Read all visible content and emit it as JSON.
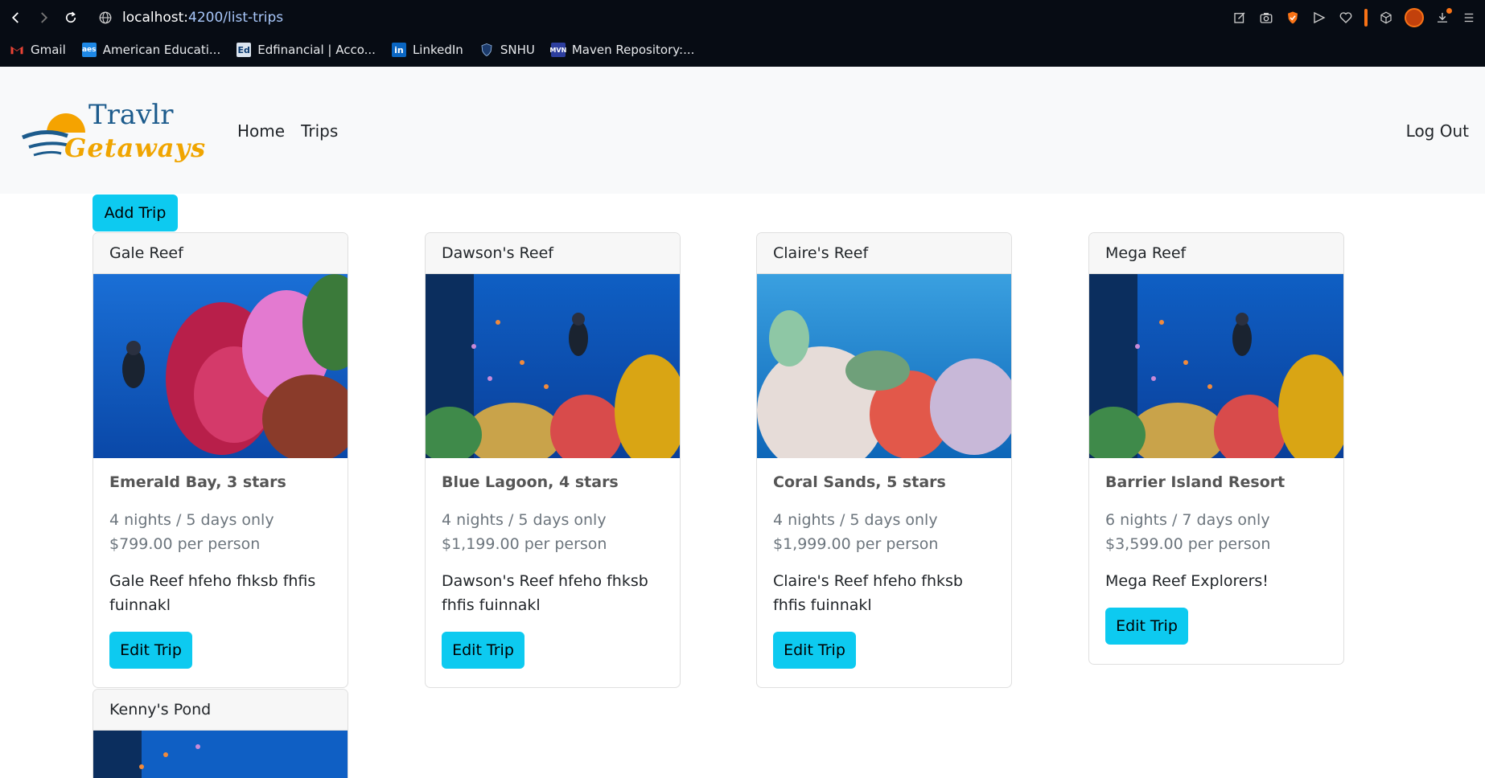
{
  "browser": {
    "url_host": "localhost:",
    "url_rest": "4200/list-trips",
    "bookmarks": [
      {
        "label": "Gmail",
        "icon": "gmail-icon"
      },
      {
        "label": "American Educati...",
        "icon": "aes-icon"
      },
      {
        "label": "Edfinancial | Acco...",
        "icon": "edfinancial-icon"
      },
      {
        "label": "LinkedIn",
        "icon": "linkedin-icon"
      },
      {
        "label": "SNHU",
        "icon": "snhu-shield-icon"
      },
      {
        "label": "Maven Repository:...",
        "icon": "maven-icon"
      }
    ]
  },
  "navbar": {
    "brand_top": "Travlr",
    "brand_bottom": "Getaways",
    "links": [
      "Home",
      "Trips"
    ],
    "logout": "Log Out"
  },
  "main": {
    "add_trip_label": "Add Trip",
    "trips": [
      {
        "name": "Gale Reef",
        "resort": "Emerald Bay, 3 stars",
        "price": "4 nights / 5 days only $799.00 per person",
        "description": "Gale Reef hfeho fhksb fhfis fuinnakl",
        "button": "Edit Trip"
      },
      {
        "name": "Dawson's Reef",
        "resort": "Blue Lagoon, 4 stars",
        "price": "4 nights / 5 days only $1,199.00 per person",
        "description": "Dawson's Reef hfeho fhksb fhfis fuinnakl",
        "button": "Edit Trip"
      },
      {
        "name": "Claire's Reef",
        "resort": "Coral Sands, 5 stars",
        "price": "4 nights / 5 days only $1,999.00 per person",
        "description": "Claire's Reef hfeho fhksb fhfis fuinnakl",
        "button": "Edit Trip"
      },
      {
        "name": "Mega Reef",
        "resort": "Barrier Island Resort",
        "price": "6 nights / 7 days only $3,599.00 per person",
        "description": "Mega Reef Explorers!",
        "button": "Edit Trip"
      },
      {
        "name": "Kenny's Pond"
      }
    ]
  },
  "colors": {
    "chrome_bg": "#070c14",
    "navbar_bg": "#f8f9fa",
    "btn_info": "#0dcaf0",
    "brand_blue": "#1c5b8c",
    "brand_orange": "#f0a500"
  }
}
